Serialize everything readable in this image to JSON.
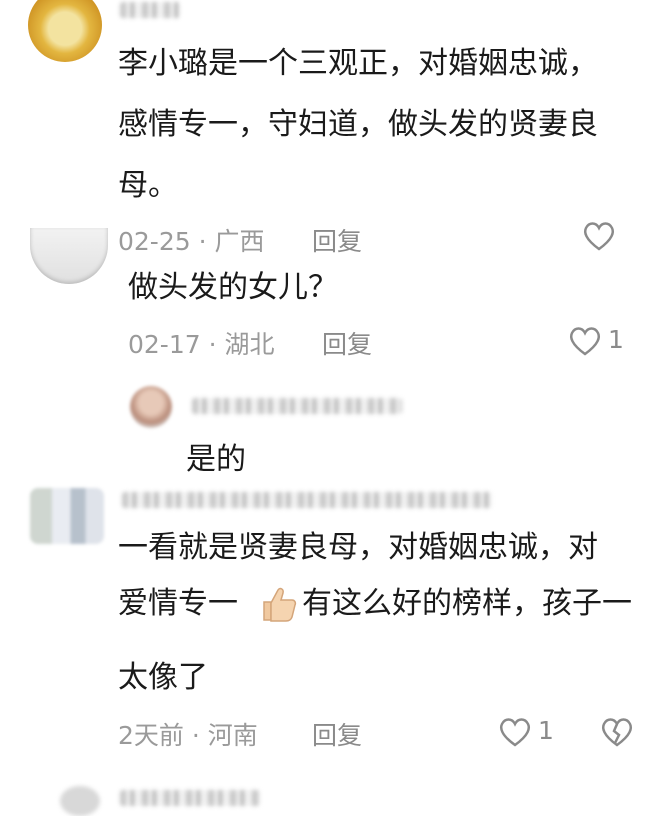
{
  "comments": [
    {
      "lines": [
        "李小璐是一个三观正，对婚姻忠诚，",
        "感情专一，守妇道，做头发的贤妻良",
        "母。"
      ],
      "meta": "02-25 · 广西",
      "reply": "回复",
      "likes": ""
    },
    {
      "lines": [
        "做头发的女儿？"
      ],
      "meta": "02-17 · 湖北",
      "reply": "回复",
      "likes": "1"
    },
    {
      "lines": [
        "是的"
      ]
    },
    {
      "lines": [
        "一看就是贤妻良母，对婚姻忠诚，对",
        "爱情专一",
        "有这么好的榜样，孩子一"
      ]
    },
    {
      "lines": [
        "太像了"
      ],
      "meta": "2天前 · 河南",
      "reply": "回复",
      "likes": "1"
    }
  ],
  "icons": {
    "heart": "heart-outline-icon",
    "broken_heart": "broken-heart-icon",
    "thumbs_up": "thumbs-up-emoji"
  },
  "colors": {
    "text": "#1a1a1a",
    "meta": "#9a9a9a",
    "background": "#ffffff"
  }
}
